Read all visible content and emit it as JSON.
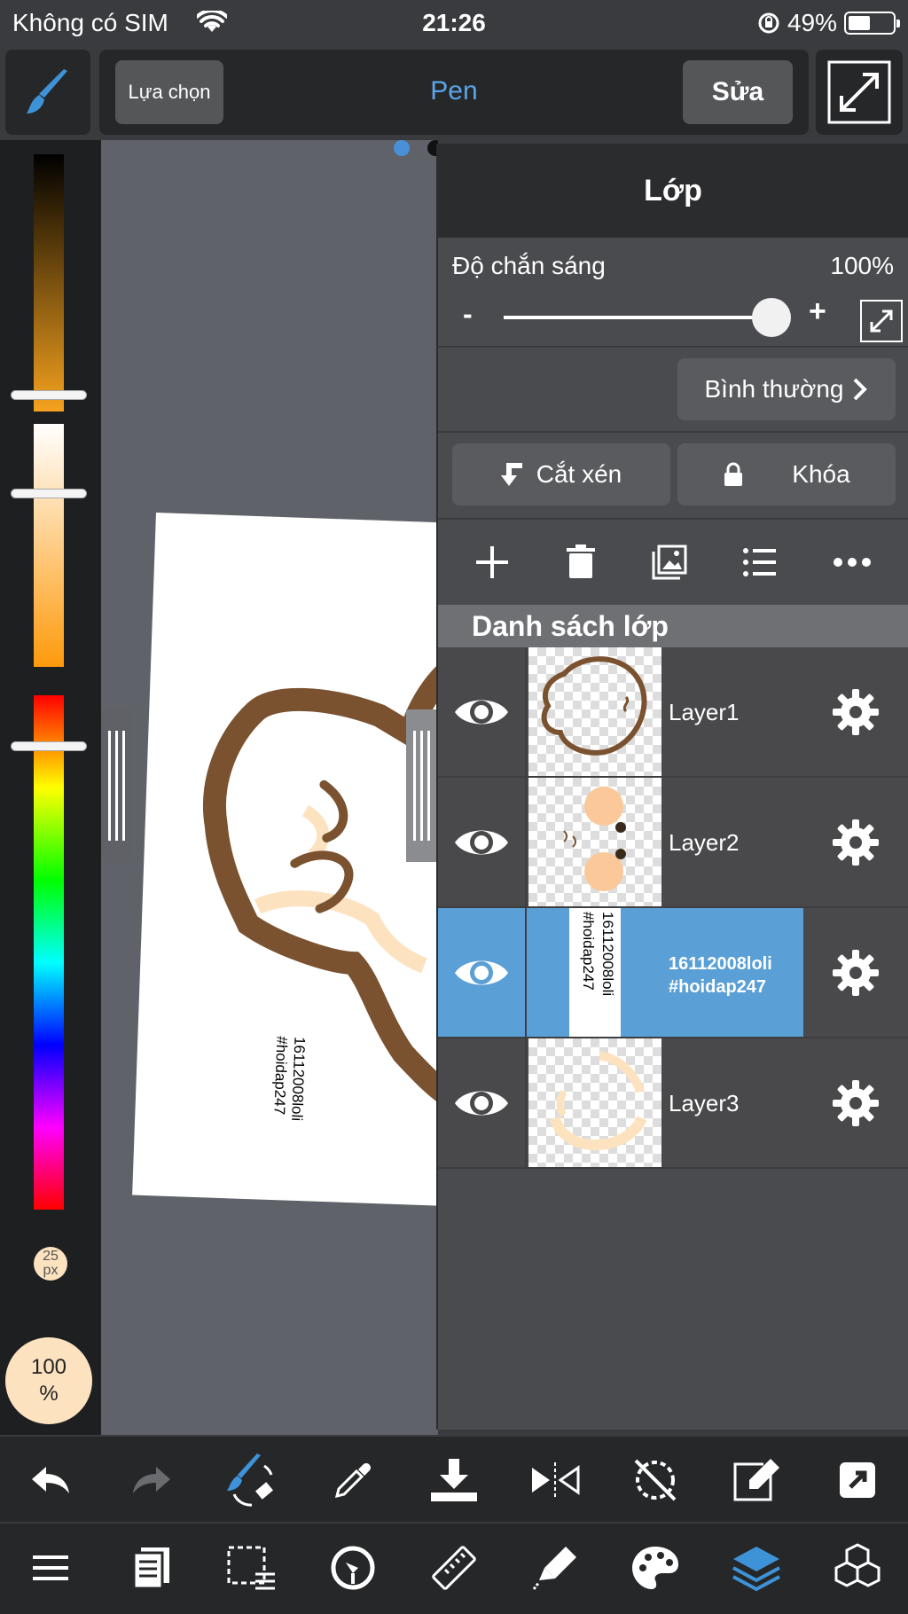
{
  "status_bar": {
    "carrier": "Không có SIM",
    "time": "21:26",
    "battery": "49%"
  },
  "toolbar": {
    "select_label": "Lựa chọn",
    "tool_name": "Pen",
    "edit_label": "Sửa"
  },
  "brush": {
    "size_value": "25",
    "size_unit": "px",
    "opacity_value": "100",
    "opacity_unit": "%"
  },
  "layer_panel": {
    "title": "Lớp",
    "opacity_label": "Độ chắn sáng",
    "opacity_value": "100%",
    "opacity_minus": "-",
    "opacity_plus": "+",
    "blend_mode": "Bình thường",
    "clip_label": "Cắt xén",
    "lock_label": "Khóa",
    "list_header": "Danh sách lớp",
    "layers": [
      {
        "name": "Layer1"
      },
      {
        "name": "Layer2"
      },
      {
        "name_line1": "16112008loli",
        "name_line2": "#hoidap247"
      },
      {
        "name": "Layer3"
      }
    ]
  },
  "canvas": {
    "watermark_line1": "16112008loli",
    "watermark_line2": "#hoidap247"
  },
  "colors": {
    "accent": "#5aa5e8",
    "active_layer": "#5a9fd6",
    "brown": "#7a5230",
    "skin": "#fde2c0"
  }
}
